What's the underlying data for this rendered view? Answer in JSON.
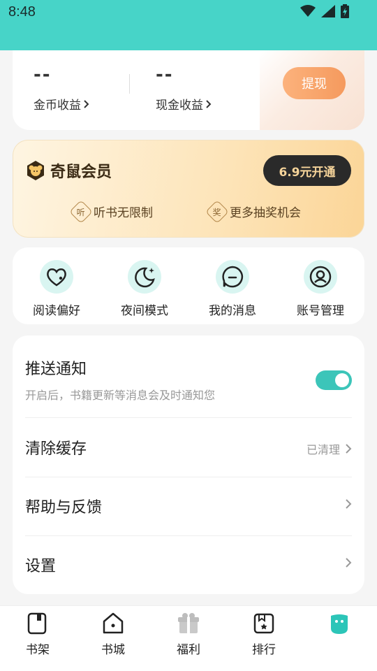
{
  "status": {
    "time": "8:48",
    "icons": [
      "wifi-icon",
      "signal-icon",
      "battery-icon"
    ]
  },
  "earnings": {
    "coin_value": "--",
    "coin_label": "金币收益",
    "cash_value": "--",
    "cash_label": "现金收益",
    "withdraw_label": "提现"
  },
  "vip": {
    "title": "奇鼠会员",
    "button": "6.9元开通",
    "perks": [
      {
        "badge": "听",
        "label": "听书无限制"
      },
      {
        "badge": "奖",
        "label": "更多抽奖机会"
      }
    ]
  },
  "quick": [
    {
      "icon": "heart-icon",
      "label": "阅读偏好"
    },
    {
      "icon": "moon-icon",
      "label": "夜间模式"
    },
    {
      "icon": "message-icon",
      "label": "我的消息"
    },
    {
      "icon": "account-icon",
      "label": "账号管理"
    }
  ],
  "settings": {
    "push_title": "推送通知",
    "push_sub": "开启后，书籍更新等消息会及时通知您",
    "push_enabled": true,
    "cache_title": "清除缓存",
    "cache_status": "已清理",
    "help_title": "帮助与反馈",
    "settings_title": "设置"
  },
  "tabs": [
    {
      "icon": "bookshelf-icon",
      "label": "书架"
    },
    {
      "icon": "bookstore-icon",
      "label": "书城"
    },
    {
      "icon": "gift-icon",
      "label": "福利"
    },
    {
      "icon": "ranking-icon",
      "label": "排行"
    },
    {
      "icon": "profile-icon",
      "label": ""
    }
  ],
  "colors": {
    "accent": "#47d4c8",
    "toggle": "#3cc5b9",
    "withdraw": "#f59a5e",
    "vip_dark": "#2a2a2a"
  }
}
